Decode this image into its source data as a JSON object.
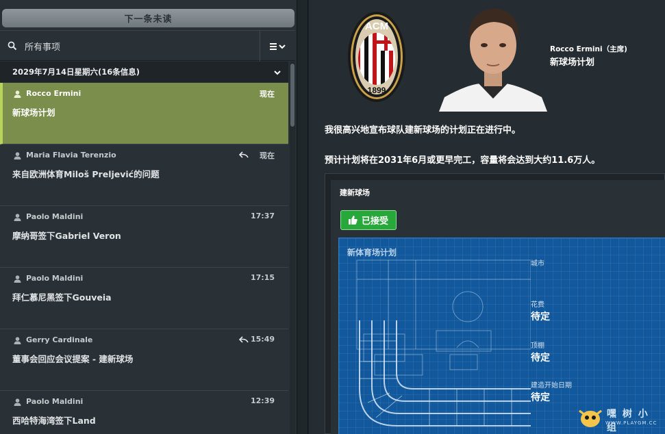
{
  "left": {
    "next_unread": "下一条未读",
    "search_label": "所有事项",
    "date_header": "2029年7月14日星期六(16条信息)",
    "messages": [
      {
        "sender": "Rocco Ermini",
        "time": "现在",
        "subject": "新球场计划",
        "selected": true,
        "replied": false
      },
      {
        "sender": "Maria Flavia Terenzio",
        "time": "现在",
        "subject": "来自欧洲体育Miloš Preljević的问题",
        "selected": false,
        "replied": true
      },
      {
        "sender": "Paolo Maldini",
        "time": "17:37",
        "subject": "摩纳哥签下Gabriel Veron",
        "selected": false,
        "replied": false
      },
      {
        "sender": "Paolo Maldini",
        "time": "17:15",
        "subject": "拜仁慕尼黑签下Gouveia",
        "selected": false,
        "replied": false
      },
      {
        "sender": "Gerry Cardinale",
        "time": "15:49",
        "subject": "董事会回应会议提案 - 建新球场",
        "selected": false,
        "replied": true
      },
      {
        "sender": "Paolo Maldini",
        "time": "12:39",
        "subject": "西哈特海湾签下Land",
        "selected": false,
        "replied": false
      }
    ]
  },
  "right": {
    "crest_text": "ACM",
    "crest_year": "1899",
    "from": "Rocco Ermini（主席)",
    "subject": "新球场计划",
    "body_1": "我很高兴地宣布球队建新球场的计划正在进行中。",
    "body_2": "预计计划将在2031年6月或更早完工，容量将会达到大约11.6万人。",
    "card": {
      "title": "建新球场",
      "accepted_label": "已接受",
      "blueprint_title": "新体育场计划",
      "fields": [
        {
          "label": "城市",
          "value": ""
        },
        {
          "label": "花费",
          "value": "待定"
        },
        {
          "label": "顶棚",
          "value": "待定"
        },
        {
          "label": "建造开始日期",
          "value": "待定"
        }
      ]
    }
  },
  "watermark": {
    "text": "嘿 树 小 组",
    "sub": "WWW.PLAYGM.CC"
  },
  "colors": {
    "selected_row": "#7b8e4b",
    "accepted": "#28a83a",
    "blueprint": "#11589c"
  }
}
